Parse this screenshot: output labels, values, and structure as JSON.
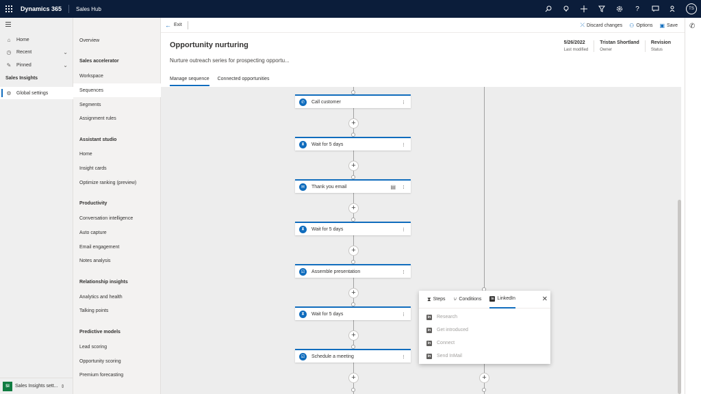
{
  "topbar": {
    "brand": "Dynamics 365",
    "app_name": "Sales Hub",
    "avatar_initials": "TS",
    "icons": [
      "search-icon",
      "lightbulb-icon",
      "plus-icon",
      "filter-icon",
      "settings-icon",
      "help-icon",
      "chat-icon",
      "person-feedback-icon"
    ]
  },
  "leftnav": {
    "items": [
      {
        "label": "Home",
        "icon": "home-icon"
      },
      {
        "label": "Recent",
        "icon": "clock-icon"
      },
      {
        "label": "Pinned",
        "icon": "pin-icon"
      }
    ],
    "group": "Sales Insights",
    "active_item": "Global settings",
    "area": {
      "badge": "SI",
      "label": "Sales Insights sett..."
    }
  },
  "subnav": {
    "overview": "Overview",
    "sections": [
      {
        "header": "Sales accelerator",
        "items": [
          "Workspace",
          "Sequences",
          "Segments",
          "Assignment rules"
        ]
      },
      {
        "header": "Assistant studio",
        "items": [
          "Home",
          "Insight cards",
          "Optimize ranking (preview)"
        ]
      },
      {
        "header": "Productivity",
        "items": [
          "Conversation intelligence",
          "Auto capture",
          "Email engagement",
          "Notes analysis"
        ]
      },
      {
        "header": "Relationship insights",
        "items": [
          "Analytics and health",
          "Talking points"
        ]
      },
      {
        "header": "Predictive models",
        "items": [
          "Lead scoring",
          "Opportunity scoring",
          "Premium forecasting"
        ]
      }
    ],
    "active": "Sequences"
  },
  "commandbar": {
    "exit": "Exit",
    "discard": "Discard changes",
    "options": "Options",
    "save": "Save"
  },
  "record": {
    "title": "Opportunity nurturing",
    "description": "Nurture outreach series for prospecting opportu...",
    "fields": [
      {
        "value": "5/26/2022",
        "label": "Last modified"
      },
      {
        "value": "Tristan Shortland",
        "label": "Owner"
      },
      {
        "value": "Revision",
        "label": "Status"
      }
    ]
  },
  "tabs": [
    "Manage sequence",
    "Connected opportunities"
  ],
  "steps": [
    {
      "label": "Call customer",
      "icon": "phone-icon"
    },
    {
      "label": "Wait for 5 days",
      "icon": "hourglass-icon"
    },
    {
      "label": "Thank you email",
      "icon": "mail-icon"
    },
    {
      "label": "Wait for 5 days",
      "icon": "hourglass-icon"
    },
    {
      "label": "Assemble presentation",
      "icon": "task-icon"
    },
    {
      "label": "Wait for 5 days",
      "icon": "hourglass-icon"
    },
    {
      "label": "Schedule a meeting",
      "icon": "task-icon"
    }
  ],
  "panel": {
    "tabs": [
      "Steps",
      "Conditions",
      "LinkedIn"
    ],
    "active_tab": "LinkedIn",
    "items": [
      "Research",
      "Get introduced",
      "Connect",
      "Send InMail"
    ]
  }
}
